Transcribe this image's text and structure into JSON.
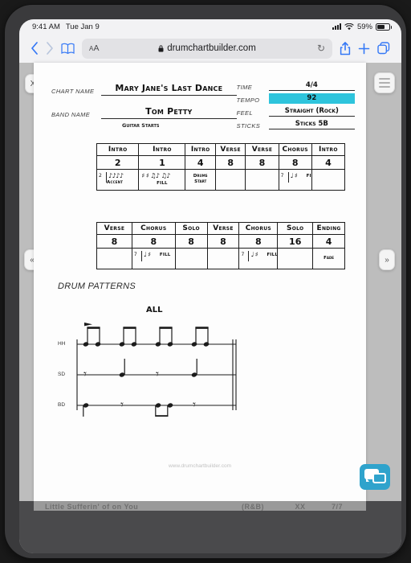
{
  "status_bar": {
    "time": "9:41 AM",
    "date": "Tue Jan 9",
    "battery_percent": "59%"
  },
  "browser": {
    "aa_label": "A",
    "aa_label_small": "A",
    "url": "drumchartbuilder.com",
    "lock_icon": "lock-icon",
    "back_icon": "‹",
    "forward_icon": "›",
    "bookmarks_icon": "bookmarks-icon",
    "reload_icon": "↻",
    "share_icon": "share-icon",
    "newtab_icon": "+",
    "tabs_icon": "tabs-icon"
  },
  "controls": {
    "close_label": "X",
    "prev_label": "«",
    "next_label": "»",
    "menu_icon": "hamburger-menu-icon"
  },
  "chart_header": {
    "chart_name_label": "CHART NAME",
    "chart_name_value": "Mary Jane's Last Dance",
    "band_name_label": "BAND NAME",
    "band_name_value": "Tom Petty",
    "meta": [
      {
        "label": "TIME",
        "value": "4/4",
        "highlight": false
      },
      {
        "label": "TEMPO",
        "value": "92",
        "highlight": true
      },
      {
        "label": "FEEL",
        "value": "Straight (Rock)",
        "highlight": false
      },
      {
        "label": "STICKS",
        "value": "Sticks 5B",
        "highlight": false
      }
    ],
    "annotation": "Guitar Starts",
    "highlight_color": "#2ec4dc"
  },
  "chart_data": {
    "type": "table",
    "title": "Mary Jane's Last Dance",
    "rows": [
      {
        "sections": [
          "Intro",
          "Intro",
          "Intro",
          "Verse",
          "Verse",
          "Chorus",
          "Intro"
        ],
        "bars": [
          "2",
          "1",
          "4",
          "8",
          "8",
          "8",
          "4"
        ],
        "widths": [
          56,
          62,
          40,
          40,
          44,
          44,
          44
        ],
        "details": [
          {
            "bar_count": "2",
            "tick": true,
            "notes": "♪♪♪♪",
            "text": "Accent"
          },
          {
            "notes": "♯ ♯ ♫♪ ♫♪",
            "text": "FILL"
          },
          {
            "text_block": "Drums\nStart"
          },
          {},
          {},
          {
            "bar_count": "7",
            "tick": true,
            "notes": "♩ ♯",
            "text": "FILL"
          },
          {}
        ]
      },
      {
        "sections": [
          "Verse",
          "Chorus",
          "Solo",
          "Verse",
          "Chorus",
          "Solo",
          "Ending"
        ],
        "bars": [
          "8",
          "8",
          "8",
          "8",
          "8",
          "16",
          "4"
        ],
        "widths": [
          44,
          54,
          40,
          40,
          48,
          44,
          40
        ],
        "details": [
          {},
          {
            "bar_count": "7",
            "tick": true,
            "notes": "♩ ♯",
            "text": "FILL"
          },
          {},
          {},
          {
            "bar_count": "7",
            "tick": true,
            "notes": "♩ ♯",
            "text": "FILL"
          },
          {},
          {
            "fade": "Fade"
          }
        ]
      }
    ]
  },
  "drum_patterns": {
    "title": "DRUM PATTERNS",
    "pattern_name": "ALL",
    "staff_lines": [
      "HH",
      "SD",
      "BD"
    ]
  },
  "footer": {
    "url": "www.drumchartbuilder.com"
  },
  "chat": {
    "icon": "chat-bubble-icon"
  },
  "bottom_list": {
    "col_a": "Little Sufferin' of on You",
    "col_b": "(R&B)",
    "col_c": "XX",
    "col_d": "7/7"
  }
}
